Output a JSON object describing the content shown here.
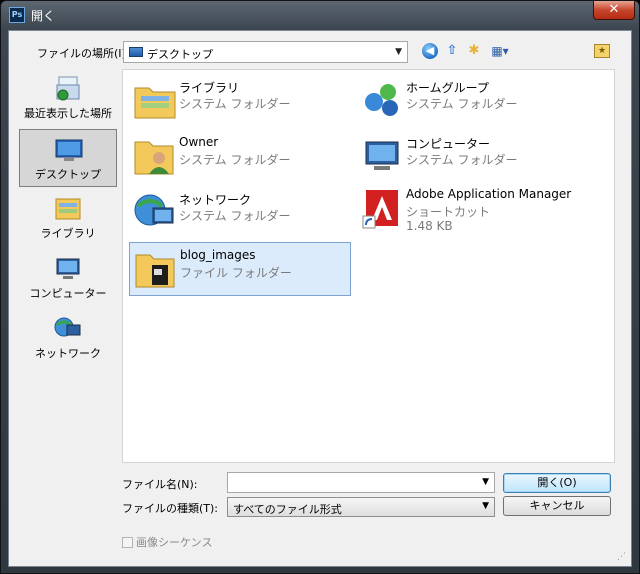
{
  "window": {
    "title": "開く",
    "app_icon": "Ps",
    "close_glyph": "✕"
  },
  "lookin": {
    "label": "ファイルの場所(I):",
    "value": "デスクトップ"
  },
  "toolbar": {
    "back": "back-icon",
    "up": "up-folder-icon",
    "new_folder": "new-folder-icon",
    "view": "view-menu-icon"
  },
  "places": [
    {
      "label": "最近表示した場所",
      "icon": "recent-places-icon"
    },
    {
      "label": "デスクトップ",
      "icon": "desktop-icon",
      "selected": true
    },
    {
      "label": "ライブラリ",
      "icon": "libraries-icon"
    },
    {
      "label": "コンピューター",
      "icon": "computer-icon"
    },
    {
      "label": "ネットワーク",
      "icon": "network-icon"
    }
  ],
  "files": [
    {
      "name": "ライブラリ",
      "type": "システム フォルダー",
      "icon": "libraries-folder-icon"
    },
    {
      "name": "ホームグループ",
      "type": "システム フォルダー",
      "icon": "homegroup-icon"
    },
    {
      "name": "Owner",
      "type": "システム フォルダー",
      "icon": "user-folder-icon"
    },
    {
      "name": "コンピューター",
      "type": "システム フォルダー",
      "icon": "computer-icon"
    },
    {
      "name": "ネットワーク",
      "type": "システム フォルダー",
      "icon": "network-icon"
    },
    {
      "name": "Adobe Application Manager",
      "type": "ショートカット",
      "size": "1.48 KB",
      "icon": "adobe-shortcut-icon"
    },
    {
      "name": "blog_images",
      "type": "ファイル フォルダー",
      "icon": "folder-icon",
      "selected": true
    }
  ],
  "filename": {
    "label": "ファイル名(N):",
    "value": ""
  },
  "filetype": {
    "label": "ファイルの種類(T):",
    "value": "すべてのファイル形式"
  },
  "buttons": {
    "open": "開く(O)",
    "cancel": "キャンセル"
  },
  "sequence": {
    "label": "画像シーケンス"
  }
}
